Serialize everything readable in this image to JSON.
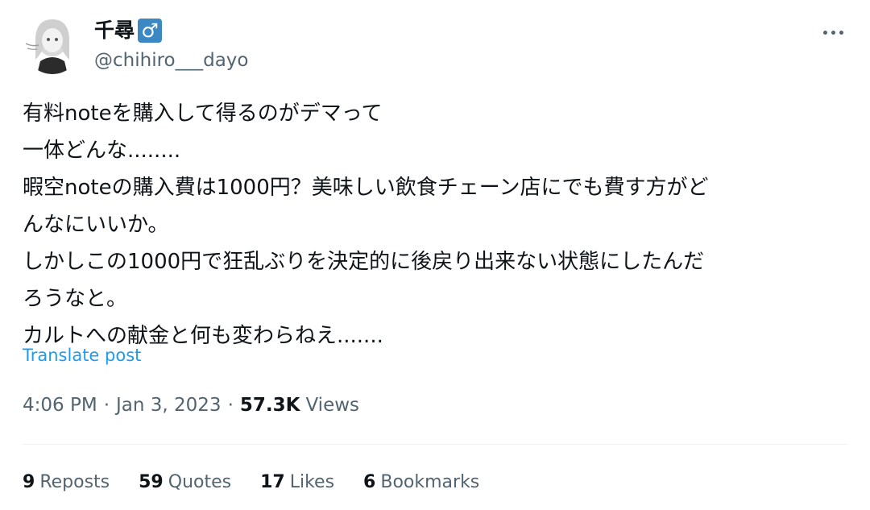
{
  "author": {
    "display_name": "千尋",
    "badge_symbol": "♂",
    "badge_color": "#3b88c3",
    "handle": "@chihiro___dayo",
    "avatar": "anime-girl-avatar"
  },
  "menu": {
    "icon": "more-horizontal-icon"
  },
  "tweet": {
    "lines": [
      "有料noteを購入して得るのがデマって",
      "一体どんな........",
      "暇空noteの購入費は1000円？美味しい飲食チェーン店にでも費す方がど",
      "んなにいいか。",
      "しかしこの1000円で狂乱ぶりを決定的に後戻り出来ない状態にしたんだ",
      "ろうなと。",
      "カルトへの献金と何も変わらねえ.......",
      ""
    ],
    "translate_label": "Translate post"
  },
  "meta": {
    "time": "4:06 PM",
    "separator": "·",
    "date": "Jan 3, 2023",
    "views_count": "57.3K",
    "views_label": "Views"
  },
  "stats": [
    {
      "count": "9",
      "label": "Reposts"
    },
    {
      "count": "59",
      "label": "Quotes"
    },
    {
      "count": "17",
      "label": "Likes"
    },
    {
      "count": "6",
      "label": "Bookmarks"
    }
  ],
  "colors": {
    "text_primary": "#0f1419",
    "text_secondary": "#536471",
    "link": "#1d9bf0",
    "divider": "#eff3f4"
  }
}
